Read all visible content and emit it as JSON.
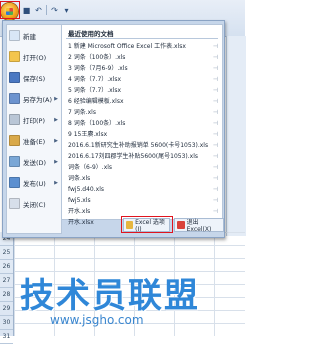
{
  "menu": {
    "left_items": [
      {
        "label": "新建",
        "icon": "new-icon",
        "color": "#d8e6f6",
        "has_arrow": false
      },
      {
        "label": "打开(O)",
        "icon": "open-folder-icon",
        "color": "#f3c54d",
        "has_arrow": false
      },
      {
        "label": "保存(S)",
        "icon": "save-icon",
        "color": "#4a78c2",
        "has_arrow": false
      },
      {
        "label": "另存为(A)",
        "icon": "save-as-icon",
        "color": "#6c93cf",
        "has_arrow": true
      },
      {
        "label": "打印(P)",
        "icon": "print-icon",
        "color": "#b9c6d6",
        "has_arrow": true
      },
      {
        "label": "准备(E)",
        "icon": "prepare-icon",
        "color": "#d9a94a",
        "has_arrow": true
      },
      {
        "label": "发送(D)",
        "icon": "send-icon",
        "color": "#7aa7d6",
        "has_arrow": true
      },
      {
        "label": "发布(U)",
        "icon": "publish-icon",
        "color": "#5b8fd0",
        "has_arrow": true
      },
      {
        "label": "关闭(C)",
        "icon": "close-doc-icon",
        "color": "#d7dfea",
        "has_arrow": false
      }
    ],
    "recent_title": "最近使用的文档",
    "recent_docs": [
      "1 新建 Microsoft Office Excel 工作表.xlsx",
      "2 词条（100条）.xls",
      "3 词条（7月6-9）.xls",
      "4 词条（7.7）.xlsx",
      "5 词条（7.7）.xlsx",
      "6 经验编辑模板.xlsx",
      "7 词条.xls",
      "8 词条（100条）.xls",
      "9 15王赓.xlsx",
      "2016.6.1新研究生补助报销单 5600(卡号1053).xls",
      "2016.6.17刘四郡学生补贴5600(尾号1053).xls",
      "词条（6-9）.xls",
      "词条.xls",
      "fwj5.d40.xls",
      "fwj5.xls",
      "开水.xls",
      "开水.xlsx"
    ],
    "pin_glyph": "⊣",
    "bottom_buttons": {
      "options": "Excel 选项(I)",
      "exit": "退出 Excel(X)"
    }
  },
  "grid": {
    "row_numbers": [
      "24",
      "25",
      "26",
      "27",
      "28",
      "29",
      "30",
      "31"
    ]
  },
  "watermark": {
    "text": "技术员联盟",
    "url": "www.jsgho.com"
  },
  "colors": {
    "highlight": "#e0141e",
    "watermark": "#2f87d8"
  }
}
